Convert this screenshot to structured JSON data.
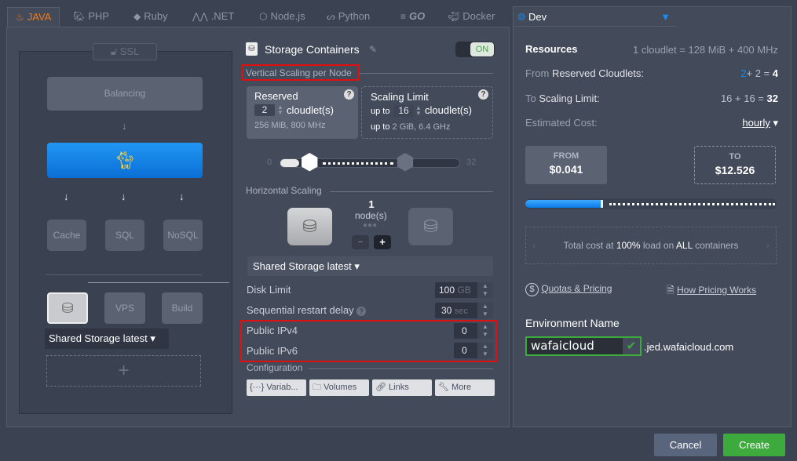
{
  "tabs": [
    {
      "label": "JAVA",
      "icon": "java-icon",
      "active": true
    },
    {
      "label": "PHP",
      "icon": "php-icon"
    },
    {
      "label": "Ruby",
      "icon": "ruby-icon"
    },
    {
      "label": ".NET",
      "icon": "dotnet-icon"
    },
    {
      "label": "Node.js",
      "icon": "nodejs-icon"
    },
    {
      "label": "Python",
      "icon": "python-icon"
    },
    {
      "label": "GO",
      "icon": "go-icon"
    },
    {
      "label": "Docker",
      "icon": "docker-icon"
    }
  ],
  "env_tab": {
    "label": "Dev",
    "icon": "globe-icon"
  },
  "topology": {
    "ssl": "SSL",
    "balancing": "Balancing",
    "cache": "Cache",
    "sql": "SQL",
    "nosql": "NoSQL",
    "vps": "VPS",
    "build": "Build",
    "storage_select": "Shared Storage latest",
    "add": "+"
  },
  "config": {
    "title": "Storage Containers",
    "toggle": "ON",
    "vertical_scaling": "Vertical Scaling per Node",
    "reserved": {
      "title": "Reserved",
      "value": "2",
      "unit": "cloudlet(s)",
      "info": "256 MiB, 800 MHz"
    },
    "limit": {
      "title": "Scaling Limit",
      "prefix": "up to",
      "value": "16",
      "unit": "cloudlet(s)",
      "info_prefix": "up to",
      "info": "2 GiB, 6.4 GHz"
    },
    "slider": {
      "min": "0",
      "max": "32",
      "reserved": 2,
      "limit": 16
    },
    "horizontal_scaling": "Horizontal Scaling",
    "nodes_count": "1",
    "nodes_label": "node(s)",
    "minus": "−",
    "plus": "+",
    "stack_select": "Shared Storage latest",
    "disk_limit": {
      "label": "Disk Limit",
      "value": "100",
      "unit": "GB"
    },
    "restart_delay": {
      "label": "Sequential restart delay",
      "value": "30",
      "unit": "sec"
    },
    "ipv4": {
      "label": "Public IPv4",
      "value": "0"
    },
    "ipv6": {
      "label": "Public IPv6",
      "value": "0"
    },
    "configuration": "Configuration",
    "buttons": [
      "{···} Variab...",
      "Volumes",
      "Links",
      "More"
    ]
  },
  "resources": {
    "title": "Resources",
    "cloudlet_def": "1 cloudlet = 128 MiB + 400 MHz",
    "from_prefix": "From",
    "from_label": "Reserved Cloudlets:",
    "from_a": "2",
    "from_b": "+ 2 =",
    "from_total": "4",
    "to_prefix": "To",
    "to_label": "Scaling Limit:",
    "to_expr": "16 + 16 =",
    "to_total": "32",
    "cost_label": "Estimated Cost:",
    "period": "hourly",
    "from_title": "FROM",
    "from_cost": "$0.041",
    "to_title": "TO",
    "to_cost": "$12.526",
    "cost_fill_percent": 31,
    "total_pre": "Total cost at",
    "total_pct": "100%",
    "total_mid": "load on",
    "total_all": "ALL",
    "total_post": "containers",
    "quotas": "Quotas & Pricing",
    "how": "How Pricing Works",
    "env_name_label": "Environment Name",
    "env_name": "wafaicloud",
    "domain": ".jed.wafaicloud.com"
  },
  "footer": {
    "cancel": "Cancel",
    "create": "Create"
  },
  "colors": {
    "accent": "#1a8cf0",
    "java": "#f07a1c",
    "create": "#3daa3d",
    "cancel": "#59647d"
  }
}
